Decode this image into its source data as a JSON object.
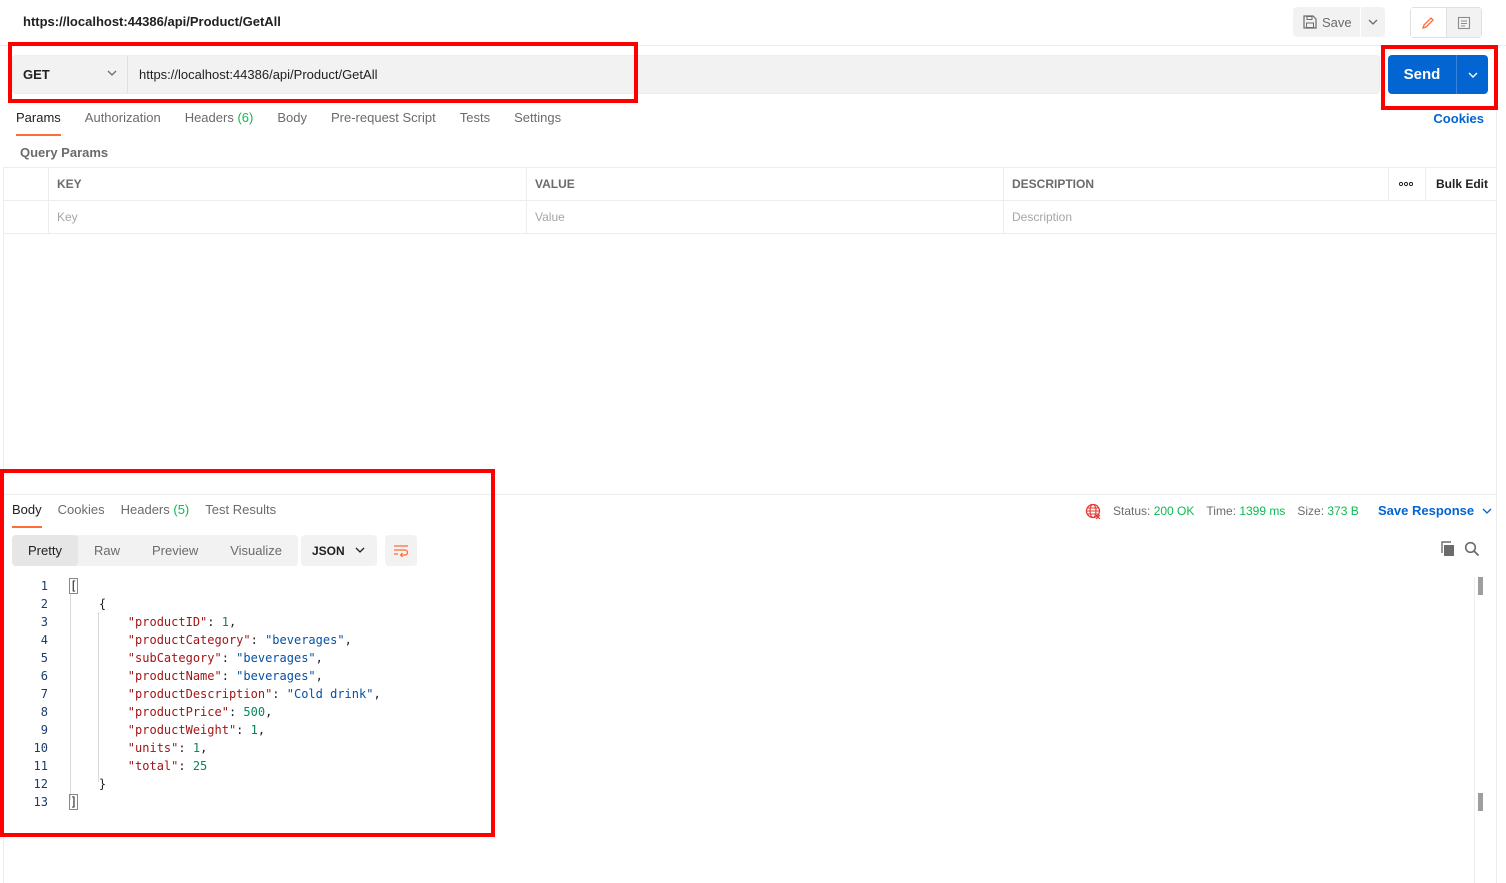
{
  "request": {
    "title": "https://localhost:44386/api/Product/GetAll",
    "method": "GET",
    "url": "https://localhost:44386/api/Product/GetAll",
    "save_label": "Save",
    "send_label": "Send"
  },
  "request_tabs": [
    {
      "label": "Params"
    },
    {
      "label": "Authorization"
    },
    {
      "label": "Headers",
      "count": "(6)"
    },
    {
      "label": "Body"
    },
    {
      "label": "Pre-request Script"
    },
    {
      "label": "Tests"
    },
    {
      "label": "Settings"
    }
  ],
  "cookies_label": "Cookies",
  "query_params": {
    "title": "Query Params",
    "headers": {
      "key": "KEY",
      "value": "VALUE",
      "description": "DESCRIPTION",
      "more": "ooo",
      "bulk_edit": "Bulk Edit"
    },
    "placeholders": {
      "key": "Key",
      "value": "Value",
      "description": "Description"
    }
  },
  "response_tabs": [
    {
      "label": "Body"
    },
    {
      "label": "Cookies"
    },
    {
      "label": "Headers",
      "count": "(5)"
    },
    {
      "label": "Test Results"
    }
  ],
  "response_meta": {
    "status_label": "Status:",
    "status_value": "200 OK",
    "time_label": "Time:",
    "time_value": "1399 ms",
    "size_label": "Size:",
    "size_value": "373 B",
    "save_response": "Save Response"
  },
  "view_modes": [
    "Pretty",
    "Raw",
    "Preview",
    "Visualize"
  ],
  "format": "JSON",
  "response_body": {
    "line_numbers": [
      "1",
      "2",
      "3",
      "4",
      "5",
      "6",
      "7",
      "8",
      "9",
      "10",
      "11",
      "12",
      "13"
    ],
    "open_array": "[",
    "open_obj": "{",
    "fields": [
      {
        "key": "\"productID\"",
        "value": "1",
        "vtype": "n",
        "comma": ","
      },
      {
        "key": "\"productCategory\"",
        "value": "\"beverages\"",
        "vtype": "s",
        "comma": ","
      },
      {
        "key": "\"subCategory\"",
        "value": "\"beverages\"",
        "vtype": "s",
        "comma": ","
      },
      {
        "key": "\"productName\"",
        "value": "\"beverages\"",
        "vtype": "s",
        "comma": ","
      },
      {
        "key": "\"productDescription\"",
        "value": "\"Cold drink\"",
        "vtype": "s",
        "comma": ","
      },
      {
        "key": "\"productPrice\"",
        "value": "500",
        "vtype": "n",
        "comma": ","
      },
      {
        "key": "\"productWeight\"",
        "value": "1",
        "vtype": "n",
        "comma": ","
      },
      {
        "key": "\"units\"",
        "value": "1",
        "vtype": "n",
        "comma": ","
      },
      {
        "key": "\"total\"",
        "value": "25",
        "vtype": "n",
        "comma": ""
      }
    ],
    "close_obj": "}",
    "close_array": "]"
  },
  "colors": {
    "accent": "#ff6c37",
    "send": "#0265d2",
    "status_ok": "#0cbb52",
    "highlight": "#ff0000"
  }
}
